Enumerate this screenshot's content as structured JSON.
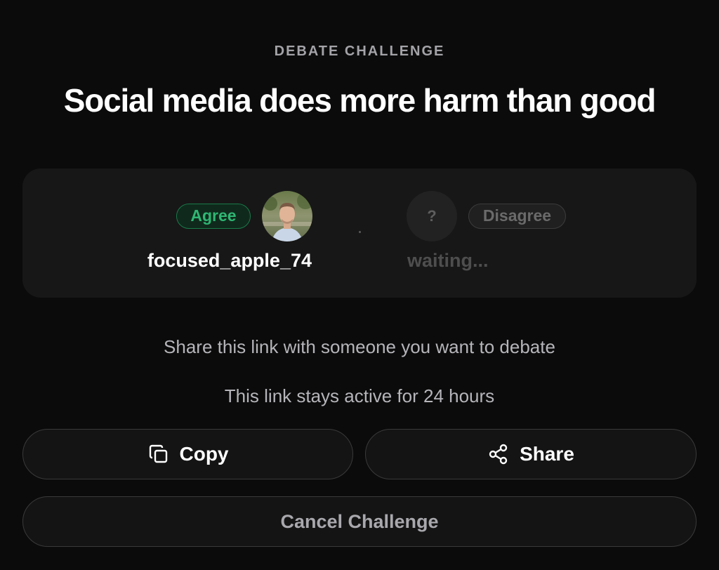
{
  "header": {
    "eyebrow": "DEBATE CHALLENGE",
    "title": "Social media does more harm than good"
  },
  "participants": {
    "challenger": {
      "stance": "Agree",
      "username": "focused_apple_74",
      "stance_color": "#2fb673"
    },
    "opponent": {
      "stance": "Disagree",
      "avatar_placeholder": "?",
      "status": "waiting..."
    }
  },
  "info": {
    "share_hint": "Share this link with someone you want to debate",
    "expiry_note": "This link stays active for 24 hours"
  },
  "actions": {
    "copy_label": "Copy",
    "copy_icon": "copy-icon",
    "share_label": "Share",
    "share_icon": "share-icon",
    "cancel_label": "Cancel Challenge"
  },
  "colors": {
    "background": "#0b0b0b",
    "card": "#171717",
    "agree_green": "#2fb673"
  }
}
